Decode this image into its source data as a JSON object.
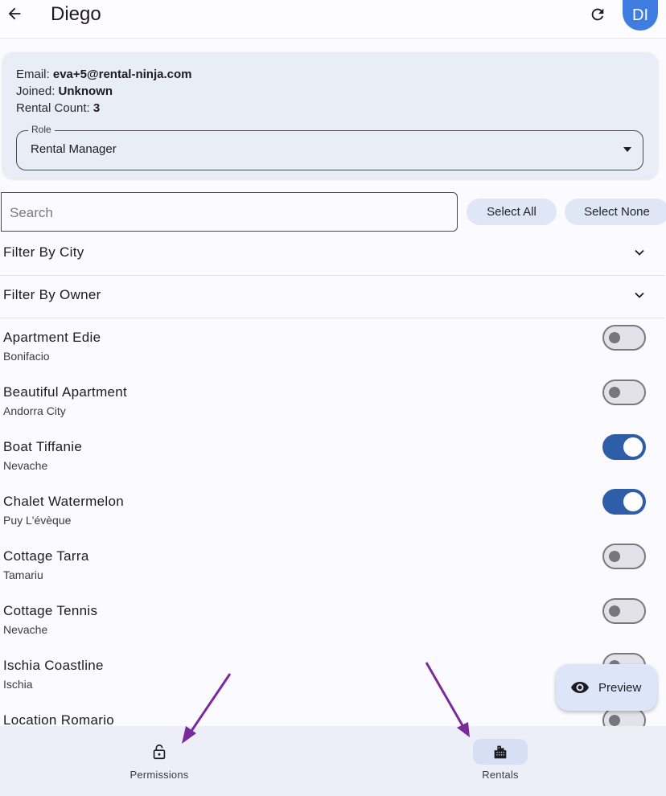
{
  "app_bar": {
    "title": "Diego",
    "avatar_initials": "DI",
    "icons": {
      "back": "arrow-left-icon",
      "refresh": "refresh-icon"
    }
  },
  "user_info": {
    "email_label": "Email:",
    "email_value": "eva+5@rental-ninja.com",
    "joined_label": "Joined:",
    "joined_value": "Unknown",
    "rental_count_label": "Rental Count:",
    "rental_count_value": "3",
    "role": {
      "label": "Role",
      "value": "Rental Manager"
    }
  },
  "search": {
    "placeholder": "Search",
    "value": ""
  },
  "actions": {
    "select_all": "Select All",
    "select_none": "Select None"
  },
  "filters": [
    {
      "label": "Filter By City"
    },
    {
      "label": "Filter By Owner"
    }
  ],
  "rentals": [
    {
      "name": "Apartment Edie",
      "city": "Bonifacio",
      "enabled": false
    },
    {
      "name": "Beautiful Apartment",
      "city": "Andorra City",
      "enabled": false
    },
    {
      "name": "Boat Tiffanie",
      "city": "Nevache",
      "enabled": true
    },
    {
      "name": "Chalet Watermelon",
      "city": "Puy L'évèque",
      "enabled": true
    },
    {
      "name": "Cottage Tarra",
      "city": "Tamariu",
      "enabled": false
    },
    {
      "name": "Cottage Tennis",
      "city": "Nevache",
      "enabled": false
    },
    {
      "name": "Ischia Coastline",
      "city": "Ischia",
      "enabled": false
    },
    {
      "name": "Location Romario",
      "city": "",
      "enabled": false
    }
  ],
  "fab": {
    "label": "Preview",
    "icon": "eye-icon"
  },
  "bottom_nav": [
    {
      "label": "Permissions",
      "icon": "lock-icon",
      "active": false
    },
    {
      "label": "Rentals",
      "icon": "building-icon",
      "active": true
    }
  ],
  "colors": {
    "accent": "#2f5ea8",
    "avatar": "#3f7de0",
    "annotation_arrow": "#7b2a9b"
  }
}
